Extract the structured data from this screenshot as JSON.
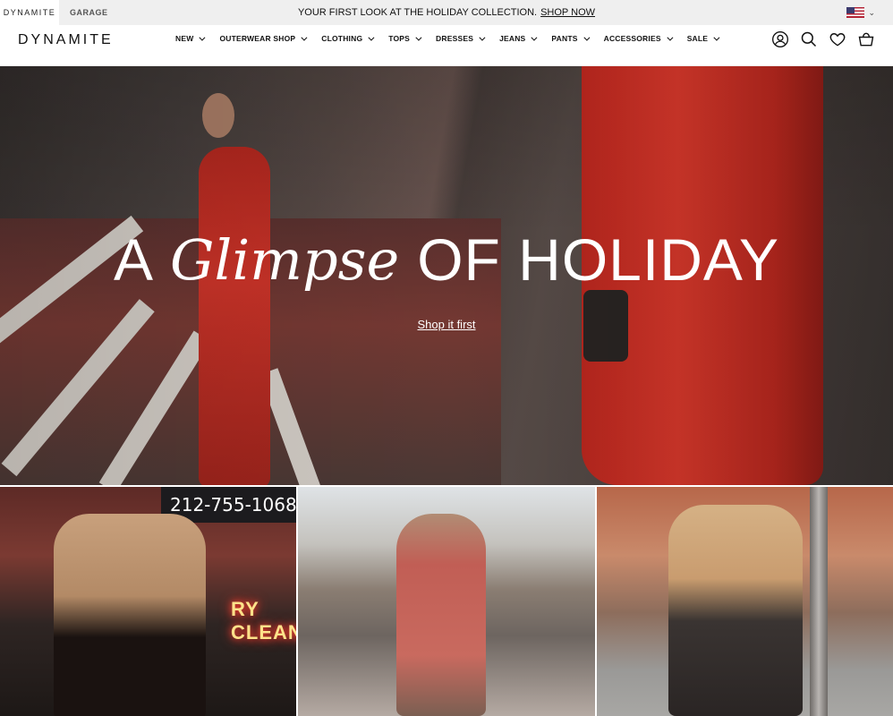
{
  "topbar": {
    "brands": [
      "DYNAMITE",
      "GARAGE"
    ],
    "promo_text": "YOUR FIRST LOOK AT THE HOLIDAY COLLECTION.",
    "promo_link": "SHOP NOW"
  },
  "header": {
    "logo": "DYNAMITE",
    "nav": [
      {
        "label": "NEW"
      },
      {
        "label": "OUTERWEAR SHOP"
      },
      {
        "label": "CLOTHING"
      },
      {
        "label": "TOPS"
      },
      {
        "label": "DRESSES"
      },
      {
        "label": "JEANS"
      },
      {
        "label": "PANTS"
      },
      {
        "label": "ACCESSORIES"
      },
      {
        "label": "SALE"
      }
    ],
    "icons": [
      "account-icon",
      "search-icon",
      "heart-icon",
      "bag-icon"
    ]
  },
  "hero": {
    "title_a": "A",
    "title_script": "Glimpse",
    "title_rest": "OF HOLIDAY",
    "cta": "Shop it first"
  },
  "tiles": {
    "tile1": {
      "sign": "212-755-1068",
      "neon": "RY CLEAN"
    }
  },
  "colors": {
    "accent_red": "#d1352a",
    "topbar_bg": "#efefef"
  }
}
